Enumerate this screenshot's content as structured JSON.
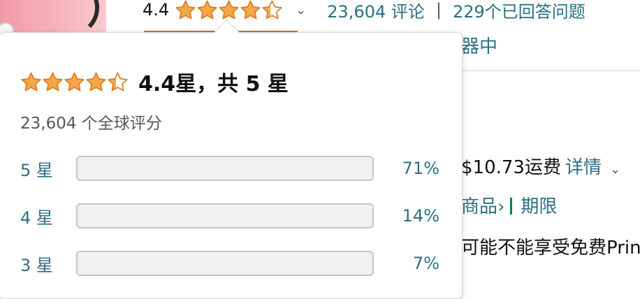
{
  "header": {
    "rating_value": "4.4",
    "stars_filled": 4.4,
    "reviews_link": "23,604 评论",
    "separator": "|",
    "qa_link": "229个已回答问题"
  },
  "background": {
    "line1": "器中",
    "shipping_text": "$10.73运费",
    "shipping_details": "详情",
    "goods_link": "商品›",
    "period_link": "期限",
    "prime_text": "可能不能享受免费Prin"
  },
  "popover": {
    "title": "4.4星，共 5 星",
    "global_ratings": "23,604 个全球评分",
    "histogram": [
      {
        "label": "5 星",
        "percent": "71%",
        "value": 71
      },
      {
        "label": "4 星",
        "percent": "14%",
        "value": 14
      },
      {
        "label": "3 星",
        "percent": "7%",
        "value": 7
      }
    ]
  },
  "colors": {
    "star": "#f3a847",
    "link": "#2b6f82",
    "bar_track": "#f0f2f2"
  }
}
